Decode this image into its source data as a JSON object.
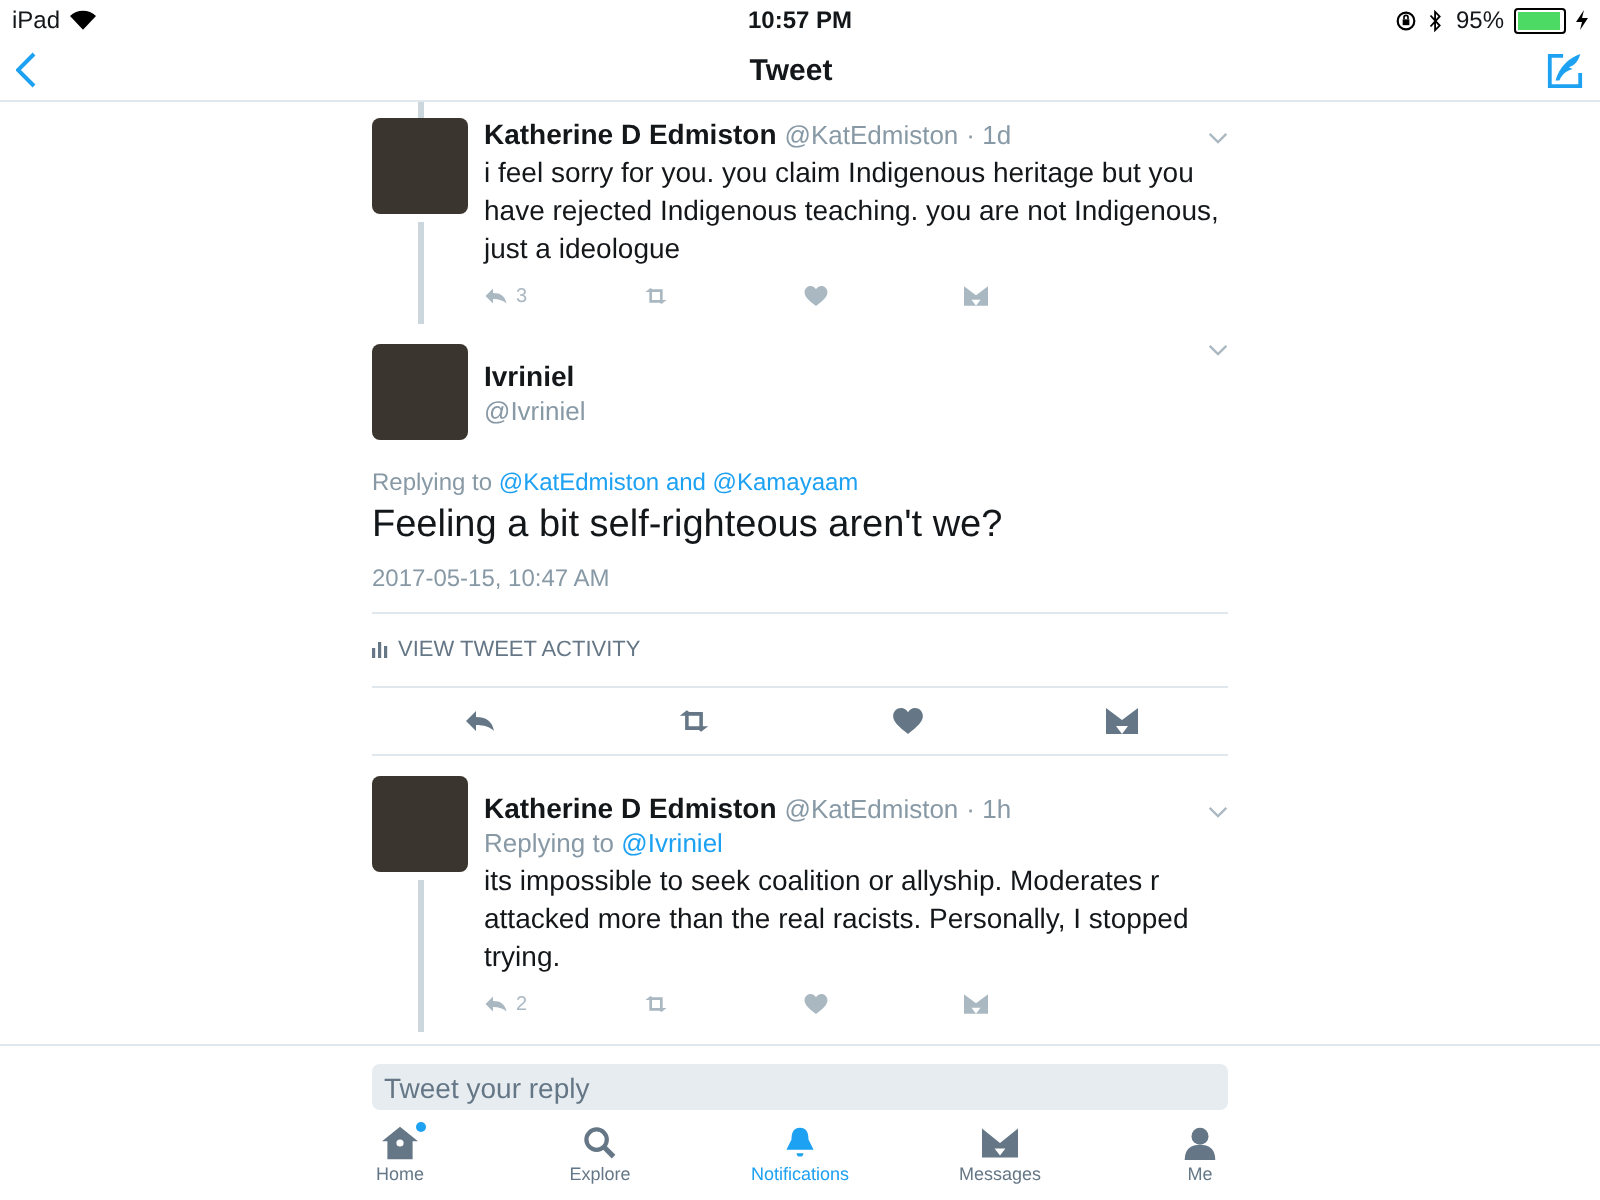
{
  "status_bar": {
    "device": "iPad",
    "time": "10:57 PM",
    "battery_text": "95%",
    "battery": {
      "level": 0.95
    },
    "charging": true
  },
  "nav": {
    "title": "Tweet"
  },
  "replies_above": [
    {
      "name": "Katherine D Edmiston",
      "handle": "@KatEdmiston",
      "time": "· 1d",
      "text": "i feel sorry for you. you claim Indigenous heritage but you have rejected Indigenous teaching. you are not Indigenous, just a ideologue",
      "reply_count": "3"
    }
  ],
  "main_tweet": {
    "name": "Ivriniel",
    "handle": "@Ivriniel",
    "replying_label": "Replying to",
    "replying_to": "@KatEdmiston and @Kamayaam",
    "text": "Feeling a bit self-righteous aren't we?",
    "timestamp": "2017-05-15, 10:47 AM",
    "activity": "VIEW TWEET ACTIVITY"
  },
  "replies_below": [
    {
      "name": "Katherine D Edmiston",
      "handle": "@KatEdmiston",
      "time": "· 1h",
      "replying_label": "Replying to",
      "replying_to": "@Ivriniel",
      "text": "its impossible to seek coalition or allyship. Moderates r attacked more than the real racists. Personally, I stopped trying.",
      "reply_count": "2"
    }
  ],
  "reply_field": {
    "placeholder": "Tweet your reply"
  },
  "tab_bar": [
    {
      "kind": "home",
      "label": "Home",
      "selected": false,
      "badge": true
    },
    {
      "kind": "explore",
      "label": "Explore",
      "selected": false,
      "badge": false
    },
    {
      "kind": "notifications",
      "label": "Notifications",
      "selected": true,
      "badge": false
    },
    {
      "kind": "messages",
      "label": "Messages",
      "selected": false,
      "badge": false
    },
    {
      "kind": "me",
      "label": "Me",
      "selected": false,
      "badge": false
    }
  ]
}
